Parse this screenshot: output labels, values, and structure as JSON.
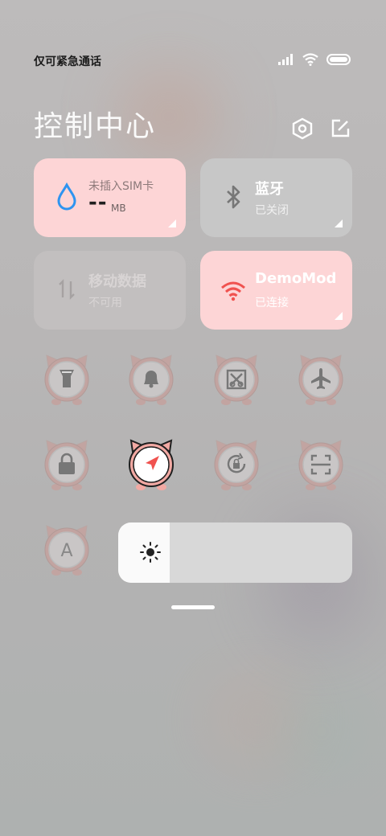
{
  "status_bar": {
    "carrier_text": "仅可紧急通话"
  },
  "header": {
    "title": "控制中心",
    "settings_icon": "settings-hex-icon",
    "edit_icon": "edit-icon"
  },
  "tiles": {
    "data_usage": {
      "label": "未插入SIM卡",
      "value": "--",
      "unit": "MB",
      "icon": "water-drop-icon",
      "color": "#2e94f0"
    },
    "bluetooth": {
      "label": "蓝牙",
      "status": "已关闭",
      "icon": "bluetooth-icon"
    },
    "mobile_data": {
      "label": "移动数据",
      "status": "不可用",
      "icon": "mobile-data-icon"
    },
    "wifi": {
      "label": "DemoMod",
      "status": "已连接",
      "icon": "wifi-icon",
      "color": "#f0524f"
    }
  },
  "toggles": [
    {
      "icon": "flashlight-icon"
    },
    {
      "icon": "bell-icon"
    },
    {
      "icon": "screenshot-icon"
    },
    {
      "icon": "airplane-icon"
    },
    {
      "icon": "lock-icon"
    },
    {
      "icon": "location-icon",
      "active": true
    },
    {
      "icon": "rotation-lock-icon"
    },
    {
      "icon": "scanner-icon"
    },
    {
      "icon": "auto-brightness-icon"
    }
  ],
  "brightness": {
    "level": 0.22,
    "icon": "sun-icon"
  },
  "colors": {
    "tile_pink": "#fdd5d6",
    "tile_gray": "#c4c4c4",
    "accent_red": "#f0524f",
    "accent_blue": "#2e94f0"
  }
}
